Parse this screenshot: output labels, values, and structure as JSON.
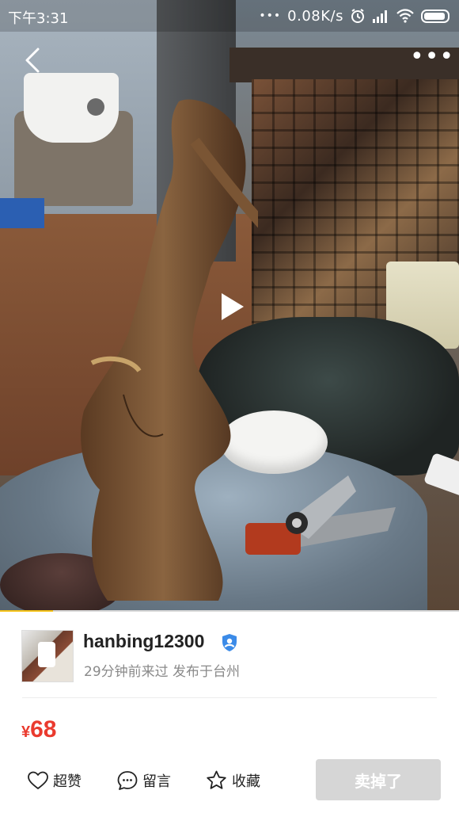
{
  "status_bar": {
    "time": "下午3:31",
    "network_speed": "0.08K/s",
    "icons": [
      "signal-dots-icon",
      "alarm-icon",
      "signal-bars-icon",
      "wifi-icon",
      "battery-icon"
    ]
  },
  "media": {
    "progress": 0.115,
    "colors": {
      "progress": "#f6c41a"
    },
    "controls": {
      "back": "back-chevron-icon",
      "more": "more-dots-icon",
      "play": "play-icon"
    }
  },
  "seller": {
    "username": "hanbing12300",
    "badge_icon": "verified-user-icon",
    "activity": "29分钟前来过 发布于台州"
  },
  "price": {
    "currency": "¥",
    "amount": "68",
    "color": "#ea3a2e"
  },
  "actions": {
    "like_label": "超赞",
    "comment_label": "留言",
    "favorite_label": "收藏",
    "sold_label": "卖掉了"
  }
}
